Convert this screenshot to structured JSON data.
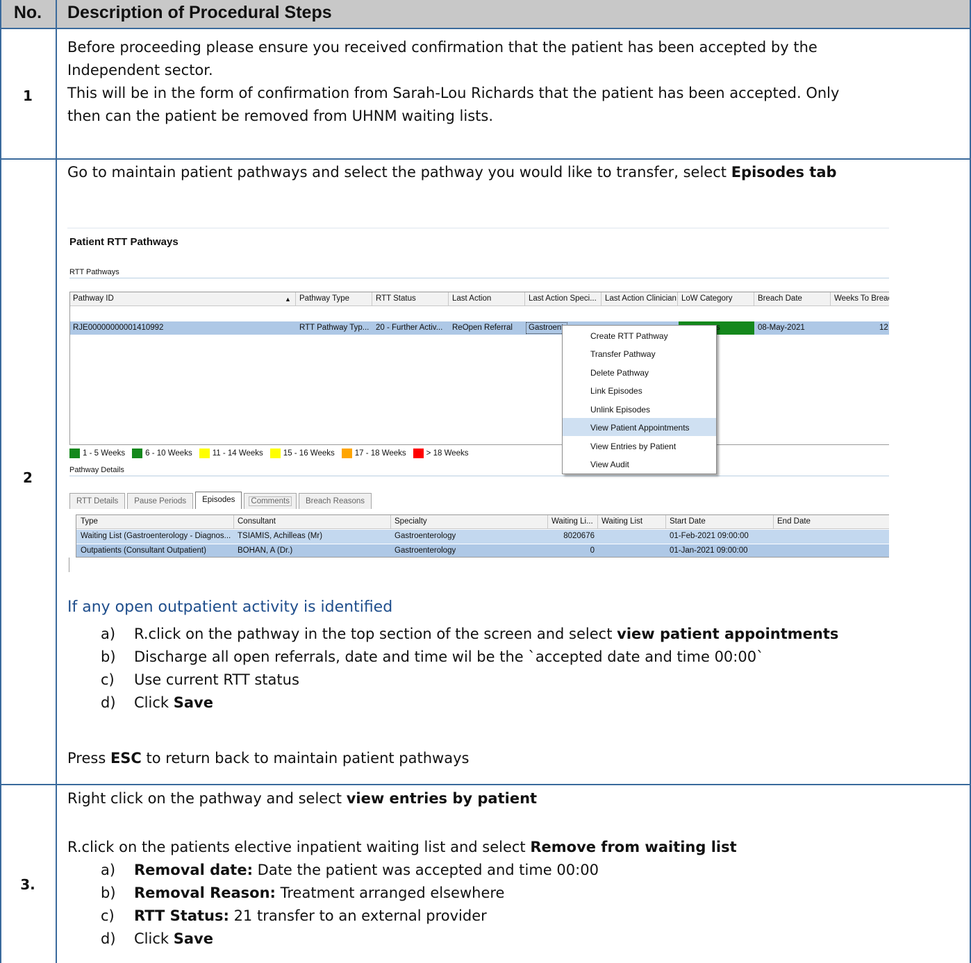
{
  "table": {
    "header_no": "No.",
    "header_desc": "Description of Procedural Steps"
  },
  "step1": {
    "no": "1",
    "line1": "Before proceeding please ensure you received confirmation that the  patient has been accepted by the",
    "line2": "Independent sector.",
    "line3": "This will be in the form of confirmation from Sarah-Lou Richards that the patient has been accepted. Only",
    "line4": "then can the patient be removed from UHNM waiting lists."
  },
  "step2": {
    "no": "2",
    "intro": "Go to maintain patient pathways and select the pathway you would like to transfer, select ",
    "intro_bold": "Episodes tab",
    "open_activity": "If any open outpatient activity is identified",
    "items": [
      {
        "label": "a)",
        "pre": "R.click on the pathway in the top section of the screen  and select ",
        "bold": "view patient appointments",
        "post": ""
      },
      {
        "label": "b)",
        "pre": "Discharge all  open referrals, date and time wil be the  `accepted date and time 00:00`",
        "bold": "",
        "post": ""
      },
      {
        "label": "c)",
        "pre": "Use  current RTT status",
        "bold": "",
        "post": ""
      },
      {
        "label": "d)",
        "pre": "Click ",
        "bold": "Save",
        "post": ""
      }
    ],
    "esc_pre": "Press ",
    "esc_bold": "ESC",
    "esc_post": " to return back to maintain patient pathways"
  },
  "step3": {
    "no": "3.",
    "line1_pre": "Right click on the pathway and select ",
    "line1_bold": "view entries by patient",
    "line2_pre": "R.click on the patients elective inpatient waiting list and select ",
    "line2_bold": "Remove from waiting list",
    "items": [
      {
        "label": "a)",
        "bold": "Removal  date:",
        "post": " Date the patient was accepted and time 00:00"
      },
      {
        "label": "b)",
        "bold": "Removal Reason:",
        "post": " Treatment arranged elsewhere"
      },
      {
        "label": "c)",
        "bold": "RTT Status:",
        "post": " 21 transfer to an external provider"
      },
      {
        "label": "d)",
        "bold": "",
        "post": "Click ",
        "bold2": "Save"
      }
    ]
  },
  "screenshot": {
    "title": "Patient RTT Pathways",
    "group_pathways": "RTT Pathways",
    "grid_headers": [
      "Pathway ID",
      "Pathway Type",
      "RTT Status",
      "Last Action",
      "Last Action Speci...",
      "Last Action Clinician",
      "LoW Category",
      "Breach Date",
      "Weeks To Breac"
    ],
    "row": {
      "pathway_id": "RJE00000000001410992",
      "pathway_type": "RTT Pathway Typ...",
      "rtt_status": "20 - Further Activ...",
      "last_action": "ReOpen Referral",
      "last_action_spec": "Gastroent",
      "low_category_tail": "s",
      "breach_date": "08-May-2021",
      "weeks_to_breach": "12"
    },
    "legend": [
      {
        "label": "1 - 5 Weeks",
        "color": "#14881c"
      },
      {
        "label": "6 - 10 Weeks",
        "color": "#14881c"
      },
      {
        "label": "11 - 14 Weeks",
        "color": "#ffff00"
      },
      {
        "label": "15 - 16 Weeks",
        "color": "#ffff00"
      },
      {
        "label": "17 - 18 Weeks",
        "color": "#ffa500"
      },
      {
        "label": "> 18 Weeks",
        "color": "#ff0000"
      }
    ],
    "group_details": "Pathway Details",
    "tabs": [
      "RTT Details",
      "Pause Periods",
      "Episodes",
      "Comments",
      "Breach Reasons"
    ],
    "active_tab": "Episodes",
    "ep_headers": [
      "Type",
      "Consultant",
      "Specialty",
      "Waiting Li...",
      "Waiting List",
      "Start Date",
      "End Date"
    ],
    "episodes": [
      {
        "type": "Waiting List (Gastroenterology - Diagnos...",
        "consultant": "TSIAMIS, Achilleas (Mr)",
        "specialty": "Gastroenterology",
        "wl_no": "8020676",
        "wl": "",
        "start": "01-Feb-2021 09:00:00",
        "end": ""
      },
      {
        "type": "Outpatients (Consultant Outpatient)",
        "consultant": "BOHAN, A (Dr.)",
        "specialty": "Gastroenterology",
        "wl_no": "0",
        "wl": "",
        "start": "01-Jan-2021 09:00:00",
        "end": ""
      }
    ],
    "context_menu": [
      "Create RTT Pathway",
      "Transfer Pathway",
      "Delete Pathway",
      "Link Episodes",
      "Unlink Episodes",
      "View Patient Appointments",
      "View Entries by Patient",
      "View Audit"
    ],
    "context_menu_highlight": "View Patient Appointments"
  }
}
